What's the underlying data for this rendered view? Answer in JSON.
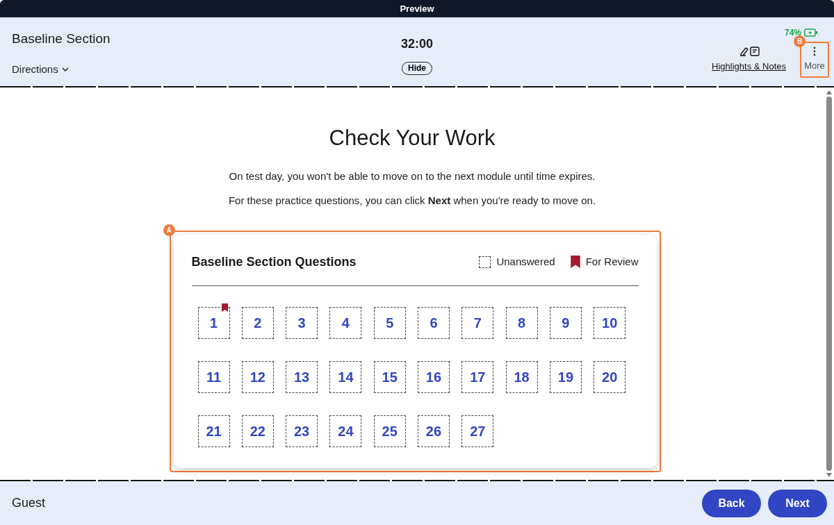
{
  "top_bar": {
    "title": "Preview"
  },
  "header": {
    "section_title": "Baseline Section",
    "directions": "Directions",
    "timer": "32:00",
    "hide_button": "Hide",
    "battery": "74%",
    "highlights_notes": "Highlights & Notes",
    "more": "More"
  },
  "callouts": [
    {
      "label": "A"
    },
    {
      "label": "B"
    }
  ],
  "main": {
    "heading": "Check Your Work",
    "lines": [
      "On test day, you won't be able to move on to the next module until time expires.",
      "For these practice questions, you can click **Next** when you're ready to move on."
    ]
  },
  "card": {
    "title": "Baseline Section Questions",
    "legend": [
      {
        "kind": "unanswered",
        "label": "Unanswered"
      },
      {
        "kind": "review",
        "label": "For Review"
      }
    ],
    "questions": [
      {
        "number": "1",
        "for_review": true
      },
      {
        "number": "2",
        "for_review": false
      },
      {
        "number": "3",
        "for_review": false
      },
      {
        "number": "4",
        "for_review": false
      },
      {
        "number": "5",
        "for_review": false
      },
      {
        "number": "6",
        "for_review": false
      },
      {
        "number": "7",
        "for_review": false
      },
      {
        "number": "8",
        "for_review": false
      },
      {
        "number": "9",
        "for_review": false
      },
      {
        "number": "10",
        "for_review": false
      },
      {
        "number": "11",
        "for_review": false
      },
      {
        "number": "12",
        "for_review": false
      },
      {
        "number": "13",
        "for_review": false
      },
      {
        "number": "14",
        "for_review": false
      },
      {
        "number": "15",
        "for_review": false
      },
      {
        "number": "16",
        "for_review": false
      },
      {
        "number": "17",
        "for_review": false
      },
      {
        "number": "18",
        "for_review": false
      },
      {
        "number": "19",
        "for_review": false
      },
      {
        "number": "20",
        "for_review": false
      },
      {
        "number": "21",
        "for_review": false
      },
      {
        "number": "22",
        "for_review": false
      },
      {
        "number": "23",
        "for_review": false
      },
      {
        "number": "24",
        "for_review": false
      },
      {
        "number": "25",
        "for_review": false
      },
      {
        "number": "26",
        "for_review": false
      },
      {
        "number": "27",
        "for_review": false
      }
    ]
  },
  "footer": {
    "user": "Guest",
    "buttons": [
      "Back",
      "Next"
    ]
  }
}
